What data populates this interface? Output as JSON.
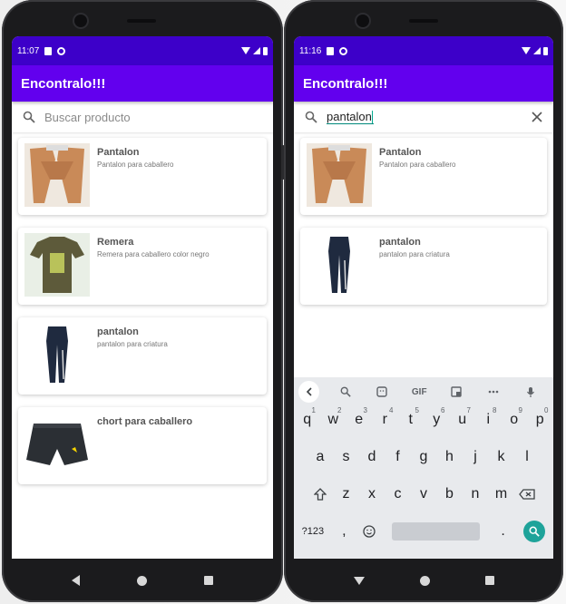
{
  "left_phone": {
    "status": {
      "time": "11:07"
    },
    "app_title": "Encontralo!!!",
    "search": {
      "placeholder": "Buscar producto",
      "value": ""
    },
    "products": [
      {
        "title": "Pantalon",
        "subtitle": "Pantalon para caballero",
        "image": "tan-pants"
      },
      {
        "title": "Remera",
        "subtitle": "Remera para caballero color negro",
        "image": "olive-tshirt"
      },
      {
        "title": "pantalon",
        "subtitle": "pantalon para criatura",
        "image": "navy-track-pants"
      },
      {
        "title": "chort para caballero",
        "subtitle": "",
        "image": "black-shorts"
      }
    ]
  },
  "right_phone": {
    "status": {
      "time": "11:16"
    },
    "app_title": "Encontralo!!!",
    "search": {
      "placeholder": "Buscar producto",
      "value": "pantalon"
    },
    "products": [
      {
        "title": "Pantalon",
        "subtitle": "Pantalon para caballero",
        "image": "tan-pants"
      },
      {
        "title": "pantalon",
        "subtitle": "pantalon para criatura",
        "image": "navy-track-pants"
      }
    ],
    "keyboard": {
      "toolbar": [
        "back-chevron-icon",
        "search-icon",
        "sticker-icon",
        "GIF",
        "translate-icon",
        "more-icon",
        "mic-icon"
      ],
      "gif_label": "GIF",
      "row1": [
        {
          "key": "q",
          "num": "1"
        },
        {
          "key": "w",
          "num": "2"
        },
        {
          "key": "e",
          "num": "3"
        },
        {
          "key": "r",
          "num": "4"
        },
        {
          "key": "t",
          "num": "5"
        },
        {
          "key": "y",
          "num": "6"
        },
        {
          "key": "u",
          "num": "7"
        },
        {
          "key": "i",
          "num": "8"
        },
        {
          "key": "o",
          "num": "9"
        },
        {
          "key": "p",
          "num": "0"
        }
      ],
      "row2": [
        "a",
        "s",
        "d",
        "f",
        "g",
        "h",
        "j",
        "k",
        "l"
      ],
      "row3": [
        "z",
        "x",
        "c",
        "v",
        "b",
        "n",
        "m"
      ],
      "symbols_label": "?123",
      "comma": ",",
      "period": "."
    }
  },
  "colors": {
    "status_bar": "#3d00c9",
    "app_bar": "#6200ee",
    "search_accent": "#00897b",
    "enter_key": "#1ea39a"
  }
}
